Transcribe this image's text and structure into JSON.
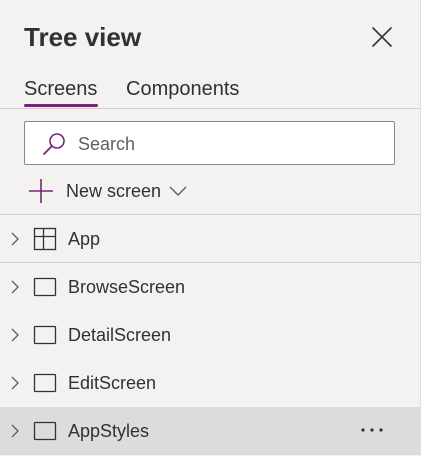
{
  "colors": {
    "accent": "#742774",
    "text": "#323130",
    "panel_bg": "#f3f2f1",
    "selected_row_bg": "#dcdcdc"
  },
  "header": {
    "title": "Tree view",
    "close_icon": "close-icon"
  },
  "tabs": [
    {
      "label": "Screens",
      "active": true
    },
    {
      "label": "Components",
      "active": false
    }
  ],
  "search": {
    "placeholder": "Search",
    "value": "",
    "icon": "search-icon"
  },
  "new_screen": {
    "label": "New screen",
    "icon": "plus-icon",
    "dropdown_icon": "chevron-down-icon"
  },
  "tree": {
    "items": [
      {
        "label": "App",
        "icon": "app-icon",
        "expand_icon": "chevron-right-icon",
        "selected": false
      },
      {
        "label": "BrowseScreen",
        "icon": "screen-icon",
        "expand_icon": "chevron-right-icon",
        "selected": false
      },
      {
        "label": "DetailScreen",
        "icon": "screen-icon",
        "expand_icon": "chevron-right-icon",
        "selected": false
      },
      {
        "label": "EditScreen",
        "icon": "screen-icon",
        "expand_icon": "chevron-right-icon",
        "selected": false
      },
      {
        "label": "AppStyles",
        "icon": "screen-icon",
        "expand_icon": "chevron-right-icon",
        "selected": true,
        "more_icon": "more-options-icon"
      }
    ]
  }
}
